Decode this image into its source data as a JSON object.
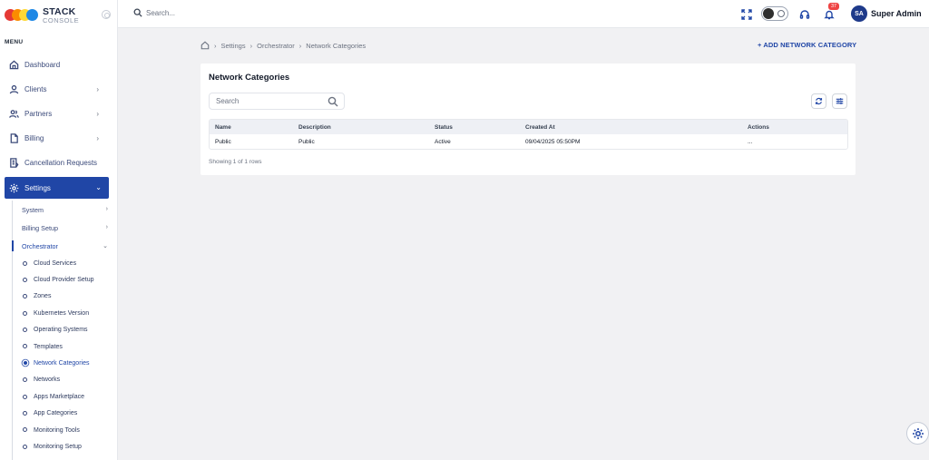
{
  "brand": {
    "name": "STACK",
    "sub": "CONSOLE"
  },
  "sidebar": {
    "menu_label": "MENU",
    "items": [
      {
        "label": "Dashboard",
        "icon": "home-icon"
      },
      {
        "label": "Clients",
        "icon": "user-icon"
      },
      {
        "label": "Partners",
        "icon": "users-icon"
      },
      {
        "label": "Billing",
        "icon": "document-icon"
      },
      {
        "label": "Cancellation Requests",
        "icon": "clipboard-icon"
      },
      {
        "label": "Settings",
        "icon": "gear-icon"
      }
    ],
    "settings_sub": [
      {
        "label": "System"
      },
      {
        "label": "Billing Setup"
      },
      {
        "label": "Orchestrator"
      }
    ],
    "orchestrator_items": [
      "Cloud Services",
      "Cloud Provider Setup",
      "Zones",
      "Kubernetes Version",
      "Operating Systems",
      "Templates",
      "Network Categories",
      "Networks",
      "Apps Marketplace",
      "App Categories",
      "Monitoring Tools",
      "Monitoring Setup"
    ]
  },
  "topbar": {
    "search_placeholder": "Search...",
    "notification_count": "37",
    "avatar_initials": "SA",
    "user_name": "Super Admin"
  },
  "breadcrumb": {
    "items": [
      "Settings",
      "Orchestrator",
      "Network Categories"
    ]
  },
  "add_button": "+ ADD NETWORK CATEGORY",
  "card": {
    "title": "Network Categories",
    "search_placeholder": "Search",
    "columns": [
      "Name",
      "Description",
      "Status",
      "Created At",
      "Actions"
    ],
    "rows": [
      {
        "name": "Public",
        "description": "Public",
        "status": "Active",
        "created": "09/04/2025 05:50PM",
        "actions": "..."
      }
    ],
    "footer": "Showing 1 of 1 rows"
  },
  "colors": {
    "accent": "#2046a6",
    "badge": "#ef4444"
  }
}
